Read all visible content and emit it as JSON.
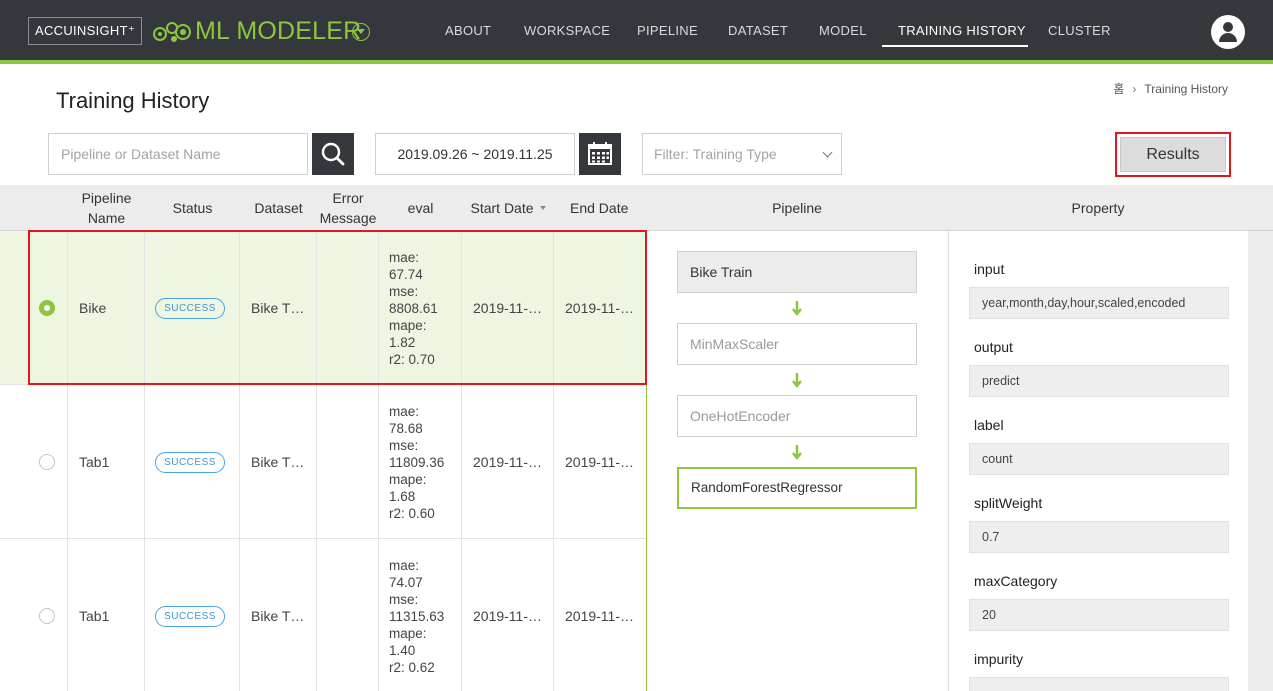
{
  "header": {
    "brand": "ACCUINSIGHT⁺",
    "app_name": "ML MODELER",
    "nav": [
      "ABOUT",
      "WORKSPACE",
      "PIPELINE",
      "DATASET",
      "MODEL",
      "TRAINING HISTORY",
      "CLUSTER"
    ],
    "active_nav": "TRAINING HISTORY",
    "accent_color": "#8dc63f"
  },
  "breadcrumb": {
    "home": "홈",
    "current": "Training History"
  },
  "page_title": "Training History",
  "toolbar": {
    "search_placeholder": "Pipeline or Dataset Name",
    "date_range": "2019.09.26 ~ 2019.11.25",
    "filter_placeholder": "Filter: Training Type",
    "results_label": "Results"
  },
  "table": {
    "columns": [
      "Pipeline Name",
      "Status",
      "Dataset",
      "Error Message",
      "eval",
      "Start Date",
      "End Date"
    ],
    "rows": [
      {
        "selected": true,
        "name": "Bike",
        "status": "SUCCESS",
        "dataset": "Bike T…",
        "error": "",
        "eval": [
          "mae:",
          "67.74",
          "mse:",
          "8808.61",
          "mape:",
          "1.82",
          "r2: 0.70"
        ],
        "start": "2019-11-…",
        "end": "2019-11-…"
      },
      {
        "selected": false,
        "name": "Tab1",
        "status": "SUCCESS",
        "dataset": "Bike T…",
        "error": "",
        "eval": [
          "mae:",
          "78.68",
          "mse:",
          "11809.36",
          "mape:",
          "1.68",
          "r2: 0.60"
        ],
        "start": "2019-11-…",
        "end": "2019-11-…"
      },
      {
        "selected": false,
        "name": "Tab1",
        "status": "SUCCESS",
        "dataset": "Bike T…",
        "error": "",
        "eval": [
          "mae:",
          "74.07",
          "mse:",
          "11315.63",
          "mape:",
          "1.40",
          "r2: 0.62"
        ],
        "start": "2019-11-…",
        "end": "2019-11-…"
      }
    ]
  },
  "pipeline": {
    "header": "Pipeline",
    "nodes": [
      "Bike Train",
      "MinMaxScaler",
      "OneHotEncoder",
      "RandomForestRegressor"
    ]
  },
  "property": {
    "header": "Property",
    "items": [
      {
        "label": "input",
        "value": "year,month,day,hour,scaled,encoded"
      },
      {
        "label": "output",
        "value": "predict"
      },
      {
        "label": "label",
        "value": "count"
      },
      {
        "label": "splitWeight",
        "value": "0.7"
      },
      {
        "label": "maxCategory",
        "value": "20"
      },
      {
        "label": "impurity",
        "value": ""
      }
    ]
  }
}
